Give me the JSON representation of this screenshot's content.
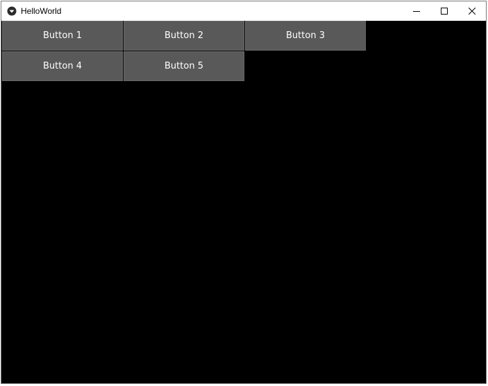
{
  "window": {
    "title": "HelloWorld",
    "icon": "kivy-logo-icon",
    "controls": [
      "minimize-icon",
      "maximize-icon",
      "close-icon"
    ]
  },
  "buttons": [
    {
      "label": "Button 1"
    },
    {
      "label": "Button 2"
    },
    {
      "label": "Button 3"
    },
    {
      "label": "Button 4"
    },
    {
      "label": "Button 5"
    }
  ],
  "colors": {
    "background": "#000000",
    "button": "#595959",
    "button_text": "#ffffff",
    "titlebar": "#ffffff"
  }
}
